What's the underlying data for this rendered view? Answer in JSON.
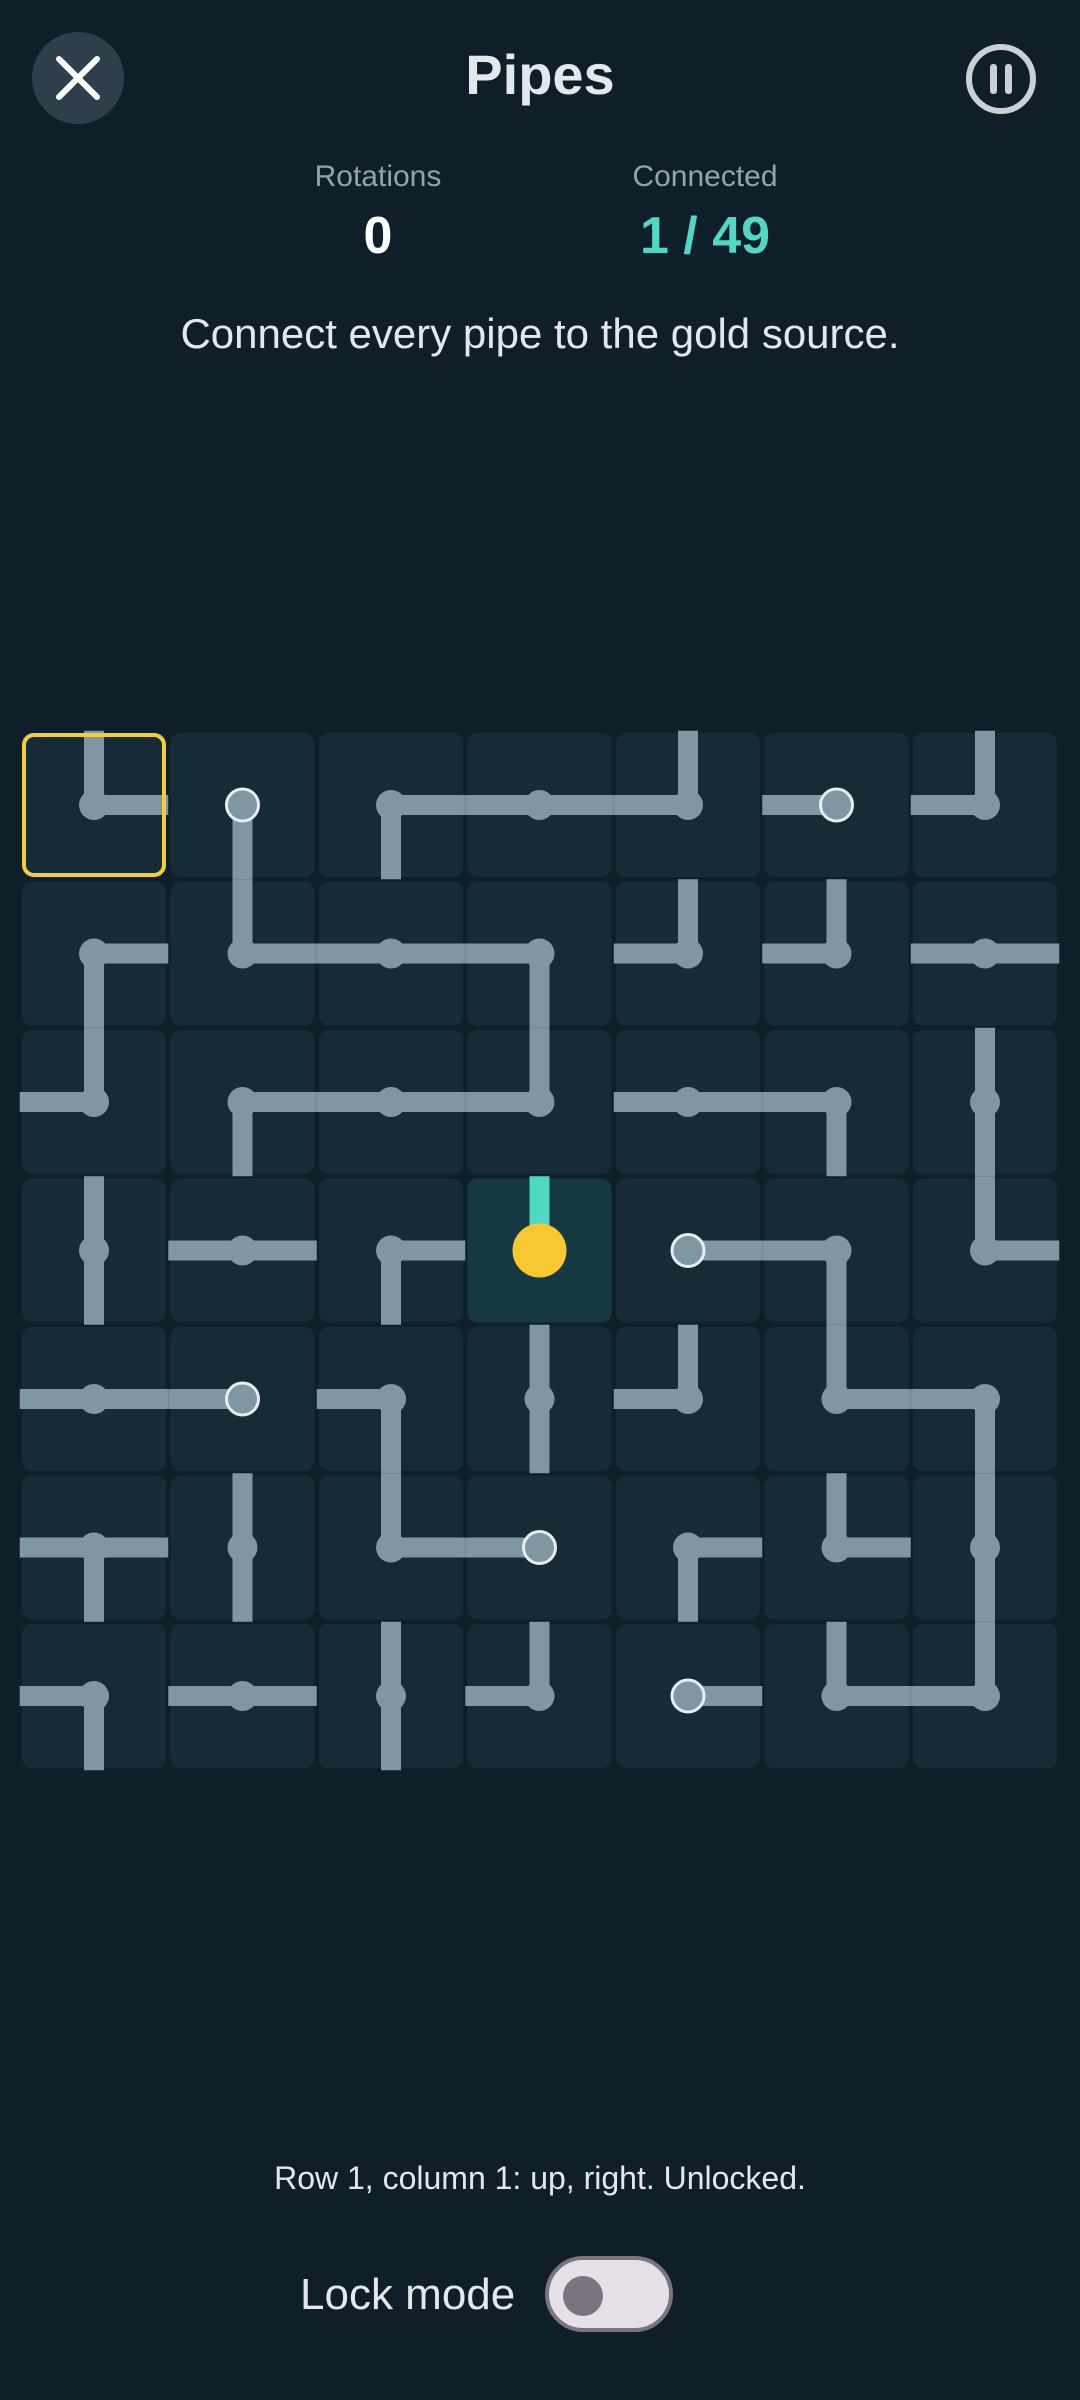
{
  "header": {
    "title": "Pipes",
    "close_icon": "close-icon",
    "pause_icon": "pause-icon"
  },
  "stats": {
    "rotations_label": "Rotations",
    "rotations_value": "0",
    "connected_label": "Connected",
    "connected_value": "1 / 49"
  },
  "instruction": "Connect every pipe to the gold source.",
  "colors": {
    "background": "#0e1f2a",
    "tile": "#172b37",
    "source_tile": "#163840",
    "pipe": "#7f96a3",
    "pipe_connected": "#4fd8c4",
    "source": "#f8c830",
    "selection": "#f2cf3a"
  },
  "grid": {
    "rows": 7,
    "cols": 7,
    "selected": [
      0,
      0
    ],
    "source": [
      3,
      3
    ],
    "cells": [
      [
        "UR",
        "D",
        "RD",
        "LR",
        "UL",
        "L",
        "UL"
      ],
      [
        "RD",
        "UR",
        "LR",
        "LD",
        "UL",
        "UL",
        "LR"
      ],
      [
        "UL",
        "RD",
        "LR",
        "UL",
        "LR",
        "LD",
        "UD"
      ],
      [
        "UD",
        "LR",
        "RD",
        "U",
        "R",
        "LD",
        "UR"
      ],
      [
        "LR",
        "L",
        "LD",
        "UD",
        "UL",
        "UR",
        "LD"
      ],
      [
        "LRD",
        "UD",
        "UR",
        "L",
        "RD",
        "UR",
        "UD"
      ],
      [
        "LD",
        "LR",
        "UD",
        "UL",
        "R",
        "UR",
        "UL"
      ]
    ]
  },
  "status_text": "Row 1, column 1: up, right. Unlocked.",
  "lock_mode": {
    "label": "Lock mode",
    "on": false
  }
}
